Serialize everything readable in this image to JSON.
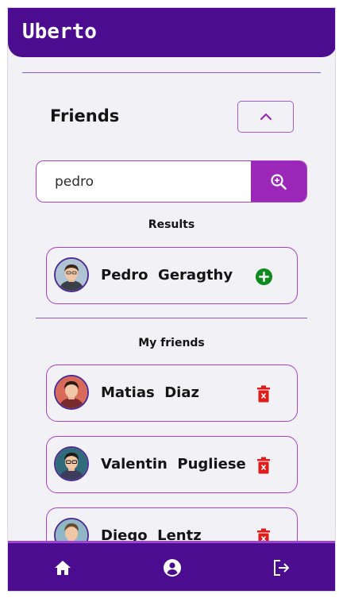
{
  "app": {
    "title": "Uberto"
  },
  "friends_section": {
    "title": "Friends"
  },
  "search": {
    "value": "pedro",
    "placeholder": ""
  },
  "results": {
    "label": "Results",
    "items": [
      {
        "name": "Pedro  Geragthy",
        "action": "add-friend-icon"
      }
    ]
  },
  "my_friends": {
    "label": "My friends",
    "items": [
      {
        "name": "Matias  Diaz",
        "action": "trash-icon"
      },
      {
        "name": "Valentin  Pugliese",
        "action": "trash-icon"
      },
      {
        "name": "Diego  Lentz",
        "action": "trash-icon"
      }
    ]
  },
  "nav": {
    "items": [
      "home-icon",
      "account-icon",
      "logout-icon"
    ]
  },
  "colors": {
    "header": "#4b0c8f",
    "accent": "#9b27b8",
    "card_border": "#a442d0",
    "add": "#0f8a1f",
    "delete": "#e01b1b"
  }
}
